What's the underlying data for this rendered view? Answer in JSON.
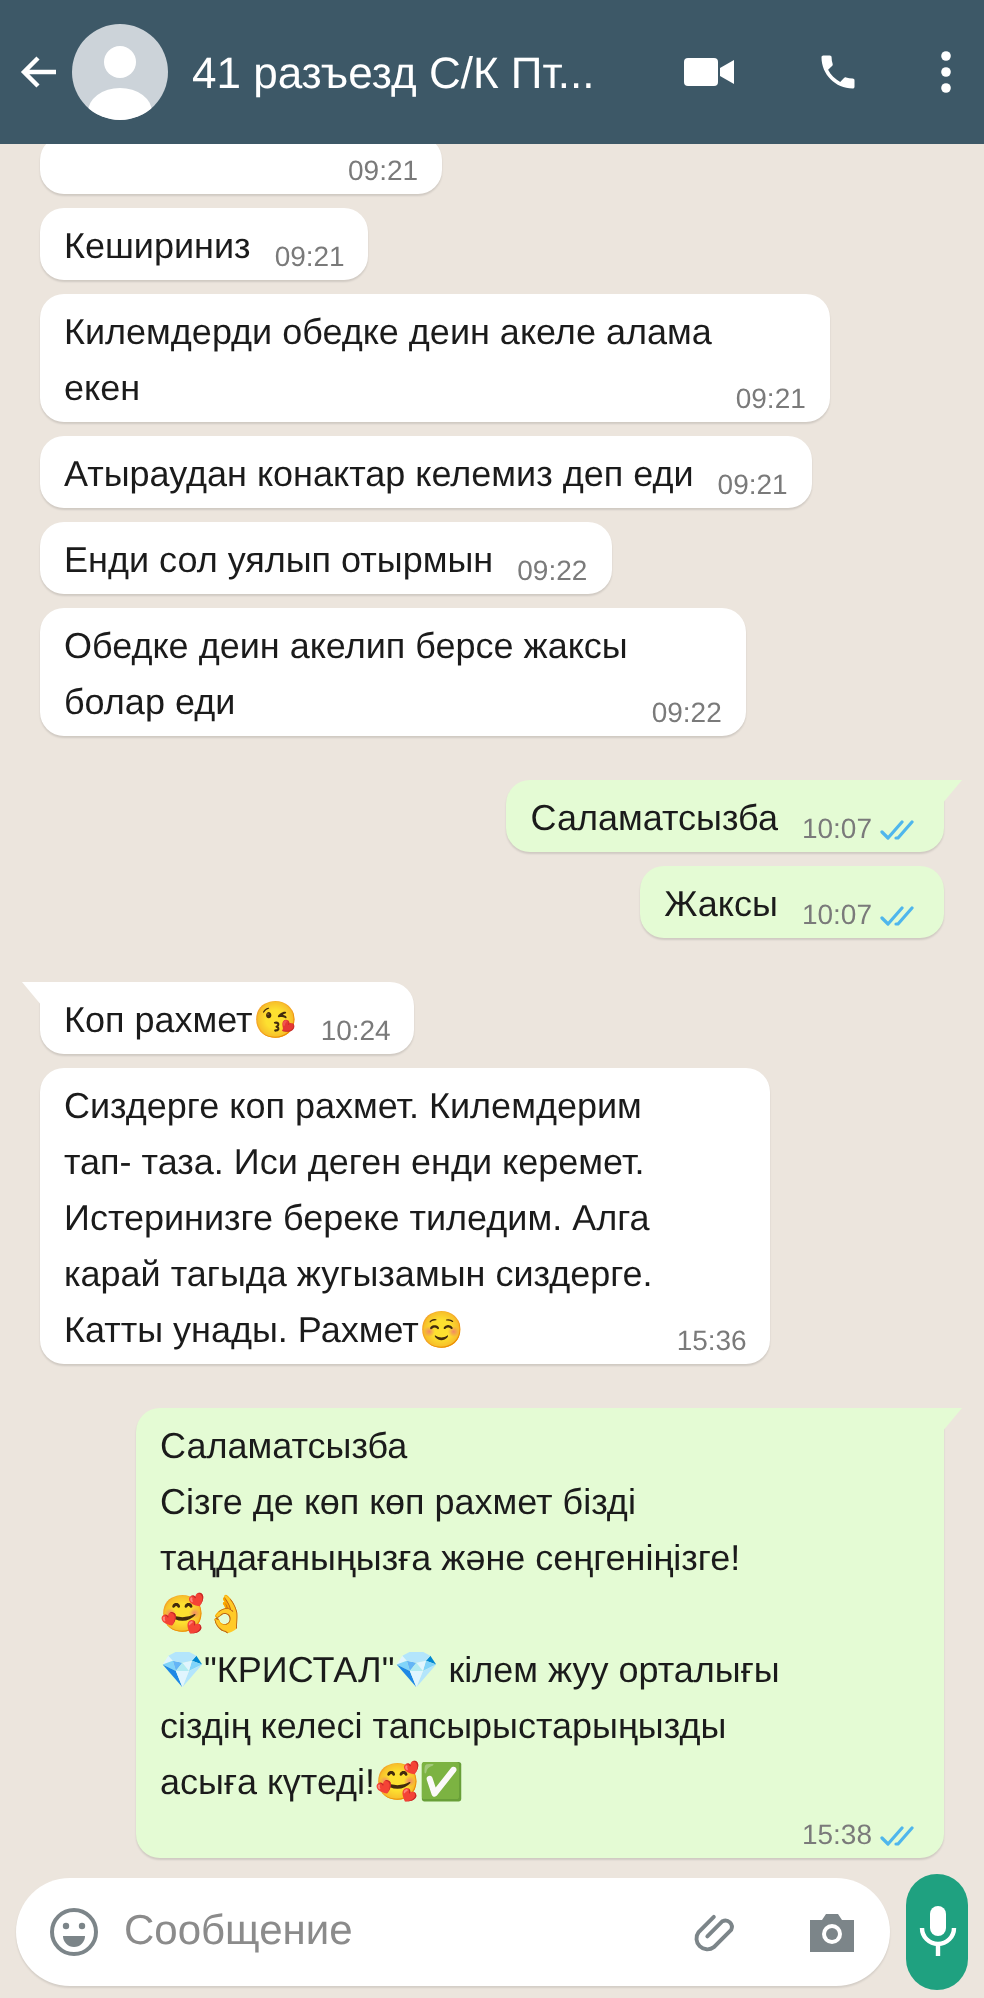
{
  "header": {
    "title": "41 разъезд С/К Пт..."
  },
  "messages": [
    {
      "outgoing": false,
      "tail": false,
      "time": "09:21"
    },
    {
      "outgoing": false,
      "tail": false,
      "text": "Кешириниз",
      "time": "09:21"
    },
    {
      "outgoing": false,
      "tail": false,
      "text": "Килемдерди обедке деин акеле алама\nекен",
      "time": "09:21"
    },
    {
      "outgoing": false,
      "tail": false,
      "text": "Атыраудан конактар келемиз деп еди",
      "time": "09:21"
    },
    {
      "outgoing": false,
      "tail": false,
      "text": "Енди сол уялып отырмын",
      "time": "09:22"
    },
    {
      "outgoing": false,
      "tail": false,
      "text": "Обедке деин акелип берсе жаксы\nболар еди",
      "time": "09:22"
    },
    {
      "outgoing": true,
      "tail": true,
      "text": "Саламатсызба",
      "time": "10:07",
      "read": true
    },
    {
      "outgoing": true,
      "tail": false,
      "text": "Жаксы",
      "time": "10:07",
      "read": true
    },
    {
      "outgoing": false,
      "tail": true,
      "text": "Коп рахмет😘",
      "time": "10:24"
    },
    {
      "outgoing": false,
      "tail": false,
      "text": "Сиздерге коп рахмет. Килемдерим\nтап- таза. Иси деген енди керемет.\nИстеринизге береке тиледим. Алга\nкарай тагыда жугызамын сиздерге.\nКатты унады. Рахмет☺️",
      "time": "15:36"
    },
    {
      "outgoing": true,
      "tail": true,
      "text": "Саламатсызба\nСізге де көп көп рахмет бізді\nтаңдағаныңызға және сеңгеніңізге!\n🥰👌\n💎\"КРИСТАЛ\"💎 кілем жуу орталығы\nсіздің келесі тапсырыстарыңызды\nасыға күтеді!🥰✅",
      "time": "15:38",
      "read": true
    }
  ],
  "composer": {
    "placeholder": "Сообщение"
  }
}
